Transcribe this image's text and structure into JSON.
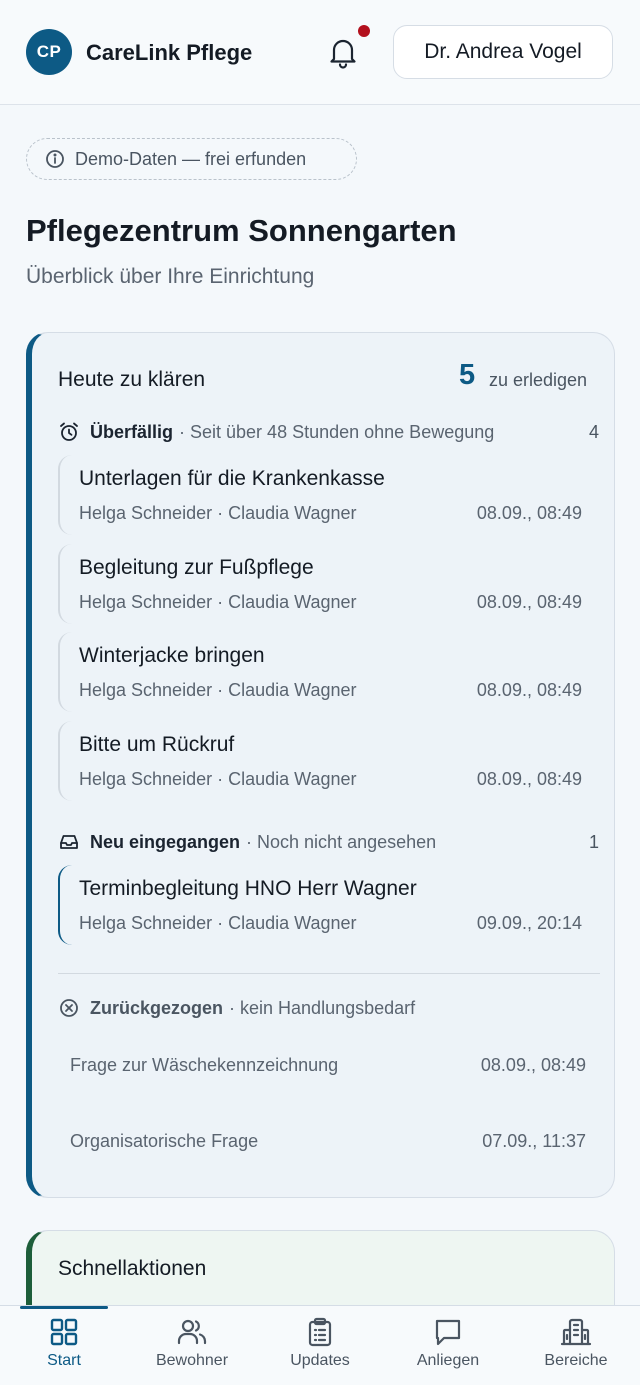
{
  "header": {
    "logo_initials": "CP",
    "app_title": "CareLink Pflege",
    "user_name": "Dr. Andrea Vogel",
    "notification_dot_color": "#b3101d"
  },
  "demo_badge": "Demo-Daten — frei erfunden",
  "page": {
    "title": "Pflegezentrum Sonnengarten",
    "subtitle": "Überblick über Ihre Einrichtung"
  },
  "today": {
    "title": "Heute zu klären",
    "count": "5",
    "count_label": "zu erledigen",
    "overdue": {
      "name": "Überfällig",
      "desc": "· Seit über 48 Stunden ohne Bewegung",
      "count": "4",
      "items": [
        {
          "title": "Unterlagen für die Krankenkasse",
          "meta": "Helga Schneider · Claudia Wagner",
          "date": "08.09., 08:49"
        },
        {
          "title": "Begleitung zur Fußpflege",
          "meta": "Helga Schneider · Claudia Wagner",
          "date": "08.09., 08:49"
        },
        {
          "title": "Winterjacke bringen",
          "meta": "Helga Schneider · Claudia Wagner",
          "date": "08.09., 08:49"
        },
        {
          "title": "Bitte um Rückruf",
          "meta": "Helga Schneider · Claudia Wagner",
          "date": "08.09., 08:49"
        }
      ]
    },
    "new": {
      "name": "Neu eingegangen",
      "desc": "· Noch nicht angesehen",
      "count": "1",
      "items": [
        {
          "title": "Terminbegleitung HNO Herr Wagner",
          "meta": "Helga Schneider · Claudia Wagner",
          "date": "09.09., 20:14"
        }
      ]
    },
    "withdrawn": {
      "name": "Zurückgezogen",
      "desc": "· kein Handlungsbedarf",
      "items": [
        {
          "title": "Frage zur Wäschekennzeichnung",
          "date": "08.09., 08:49"
        },
        {
          "title": "Organisatorische Frage",
          "date": "07.09., 11:37"
        }
      ]
    }
  },
  "quick_actions": {
    "title": "Schnellaktionen"
  },
  "nav": {
    "items": [
      {
        "label": "Start",
        "icon": "grid-icon"
      },
      {
        "label": "Bewohner",
        "icon": "users-icon"
      },
      {
        "label": "Updates",
        "icon": "clipboard-icon"
      },
      {
        "label": "Anliegen",
        "icon": "chat-icon"
      },
      {
        "label": "Bereiche",
        "icon": "building-icon"
      }
    ]
  }
}
